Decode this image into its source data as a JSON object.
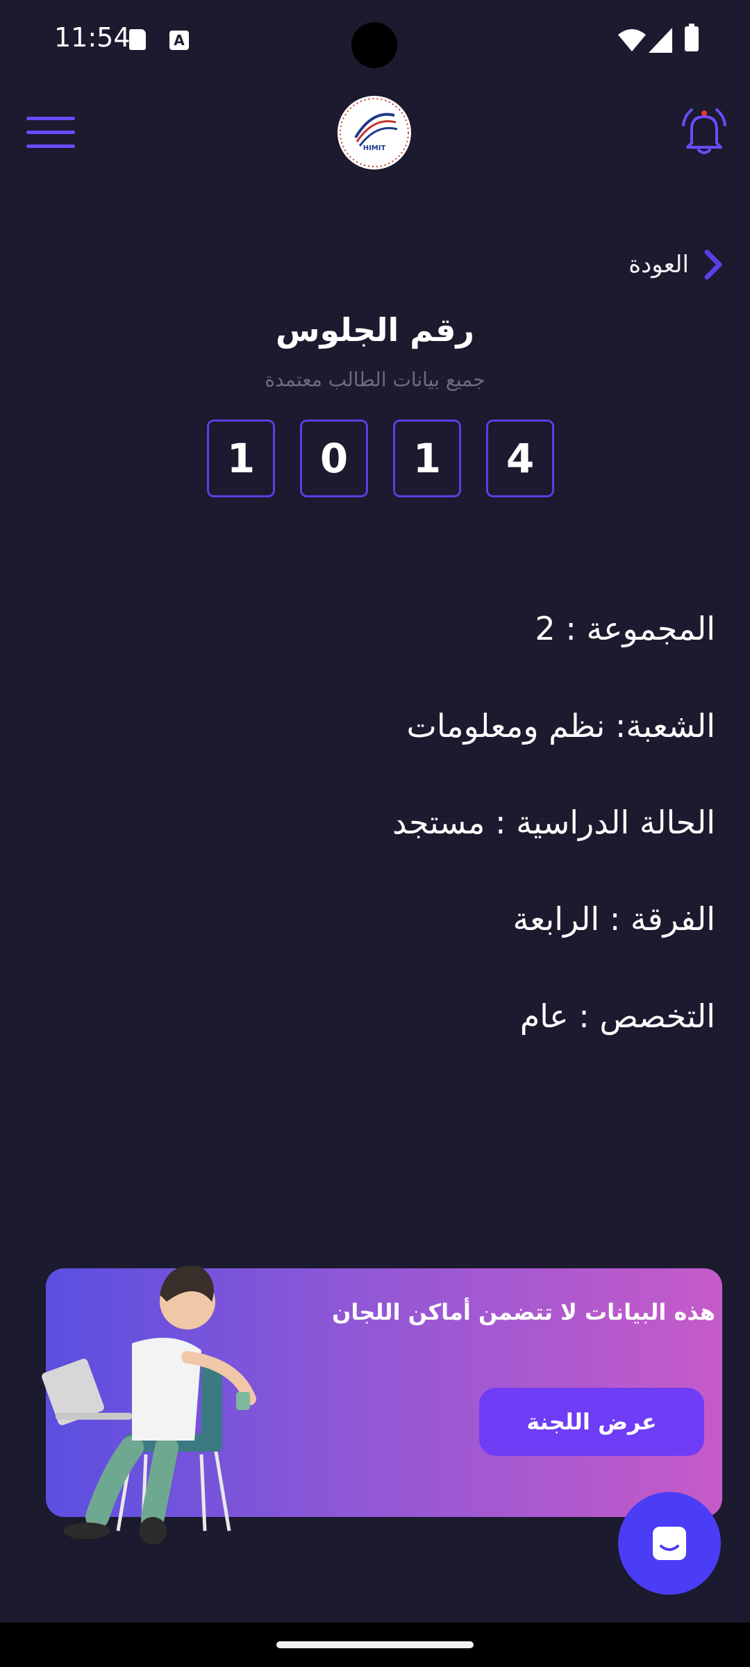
{
  "status_bar": {
    "time": "11:54",
    "icons": [
      "sd-card-icon",
      "keyboard-a-icon",
      "wifi-icon",
      "signal-icon",
      "battery-icon"
    ]
  },
  "app_bar": {
    "logo_text": "HIMIT",
    "icons": [
      "menu-icon",
      "bell-icon"
    ],
    "accent_color": "#6b4bff"
  },
  "back": {
    "label": "العودة"
  },
  "header": {
    "title": "رقم الجلوس",
    "subtitle": "جميع بيانات الطالب معتمدة"
  },
  "seat_number": {
    "digits": [
      "1",
      "0",
      "1",
      "4"
    ]
  },
  "info": {
    "group": "المجموعة : 2",
    "division": "الشعبة: نظم ومعلومات",
    "status": "الحالة الدراسية : مستجد",
    "level": "الفرقة : الرابعة",
    "specialization": "التخصص : عام"
  },
  "banner": {
    "text": "هذه البيانات لا تتضمن أماكن اللجان",
    "button_label": "عرض اللجنة"
  },
  "colors": {
    "background": "#1b1a2e",
    "digit_border": "#5b3ee6",
    "button": "#6e3df5",
    "fab": "#4b3cf5"
  }
}
